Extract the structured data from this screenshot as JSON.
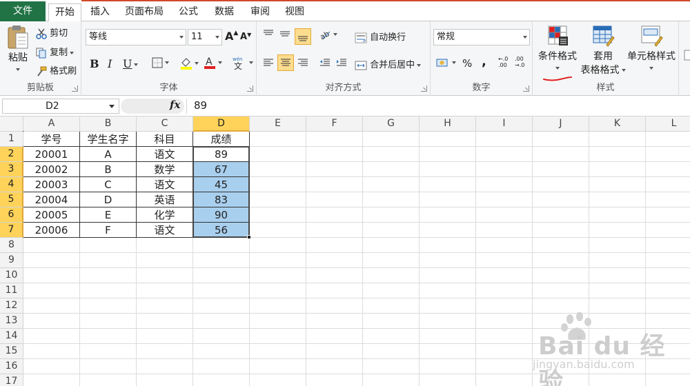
{
  "tabs": [
    {
      "id": "file",
      "label": "文件"
    },
    {
      "id": "home",
      "label": "开始"
    },
    {
      "id": "insert",
      "label": "插入"
    },
    {
      "id": "layout",
      "label": "页面布局"
    },
    {
      "id": "formula",
      "label": "公式"
    },
    {
      "id": "data",
      "label": "数据"
    },
    {
      "id": "review",
      "label": "审阅"
    },
    {
      "id": "view",
      "label": "视图"
    }
  ],
  "ribbon": {
    "clipboard": {
      "group": "剪贴板",
      "paste": "粘贴",
      "cut": "剪切",
      "copy": "复制",
      "format_painter": "格式刷"
    },
    "font": {
      "group": "字体",
      "font_name": "等线",
      "font_size": "11",
      "bold": "B",
      "italic": "I",
      "underline": "U"
    },
    "alignment": {
      "group": "对齐方式",
      "wrap_text": "自动换行",
      "merge_center": "合并后居中"
    },
    "number": {
      "group": "数字",
      "format": "常规",
      "percent": "%",
      "comma": ",",
      "inc_decimal": ".00",
      "dec_decimal": ".00"
    },
    "styles": {
      "group": "样式",
      "conditional_format_line1": "条件格式",
      "table_format_line1": "套用",
      "table_format_line2": "表格格式",
      "cell_styles": "单元格样式"
    }
  },
  "formula_bar": {
    "name_box": "D2",
    "fx": "fx",
    "value": "89"
  },
  "grid": {
    "columns": [
      "A",
      "B",
      "C",
      "D",
      "E",
      "F",
      "G",
      "H",
      "I",
      "J",
      "K",
      "L"
    ],
    "rows": [
      "1",
      "2",
      "3",
      "4",
      "5",
      "6",
      "7",
      "8",
      "9",
      "10",
      "11",
      "12",
      "13",
      "14",
      "15",
      "16",
      "17"
    ],
    "header": [
      "学号",
      "学生名字",
      "科目",
      "成绩"
    ],
    "data": [
      [
        "20001",
        "A",
        "语文",
        "89"
      ],
      [
        "20002",
        "B",
        "数学",
        "67"
      ],
      [
        "20003",
        "C",
        "语文",
        "45"
      ],
      [
        "20004",
        "D",
        "英语",
        "83"
      ],
      [
        "20005",
        "E",
        "化学",
        "90"
      ],
      [
        "20006",
        "F",
        "语文",
        "56"
      ]
    ],
    "selected_column": "D",
    "selected_rows": [
      "2",
      "3",
      "4",
      "5",
      "6",
      "7"
    ]
  },
  "colors": {
    "excel_green": "#217346",
    "selection_fill": "#a9cfee",
    "header_highlight": "#ffd359",
    "annotation_red": "#e02020"
  },
  "watermark": {
    "main": "Bai du 经验",
    "sub": "jingyan.baidu.com"
  }
}
